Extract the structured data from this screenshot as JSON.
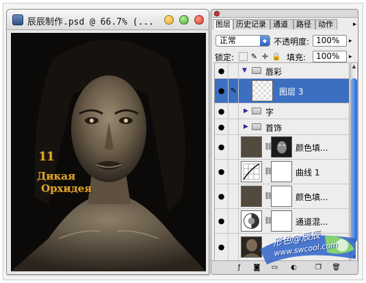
{
  "document": {
    "title": "辰辰制作.psd @ 66.7% (...",
    "logo": {
      "number": "11",
      "line1": "Дикая",
      "line2": "Орхидея"
    }
  },
  "layers_panel": {
    "tabs": [
      {
        "label": "图层",
        "active": true
      },
      {
        "label": "历史记录",
        "active": false
      },
      {
        "label": "通道",
        "active": false
      },
      {
        "label": "路径",
        "active": false
      },
      {
        "label": "动作",
        "active": false
      }
    ],
    "tab_menu_icon": "▸",
    "blend_mode": "正常",
    "opacity_label": "不透明度:",
    "opacity_value": "100%",
    "lock_label": "锁定:",
    "fill_label": "填充:",
    "fill_value": "100%",
    "layers": [
      {
        "name": "唇彩",
        "kind": "group",
        "expanded": true,
        "selected": false
      },
      {
        "name": "图层 3",
        "kind": "layer",
        "selected": true
      },
      {
        "name": "字",
        "kind": "group",
        "expanded": false,
        "selected": false
      },
      {
        "name": "首饰",
        "kind": "group",
        "expanded": false,
        "selected": false
      },
      {
        "name": "颜色填...",
        "kind": "fill",
        "selected": false
      },
      {
        "name": "曲线 1",
        "kind": "curves",
        "selected": false
      },
      {
        "name": "颜色填...",
        "kind": "fill",
        "selected": false
      },
      {
        "name": "通道混...",
        "kind": "mixer",
        "selected": false
      },
      {
        "name": "",
        "kind": "background",
        "selected": false
      }
    ],
    "colors": {
      "selected_row": "#3d6fc0",
      "fill_swatch": "#534a3e"
    }
  },
  "watermark": {
    "line1": "形色@辰辰",
    "line2": "www.swcool.com"
  }
}
